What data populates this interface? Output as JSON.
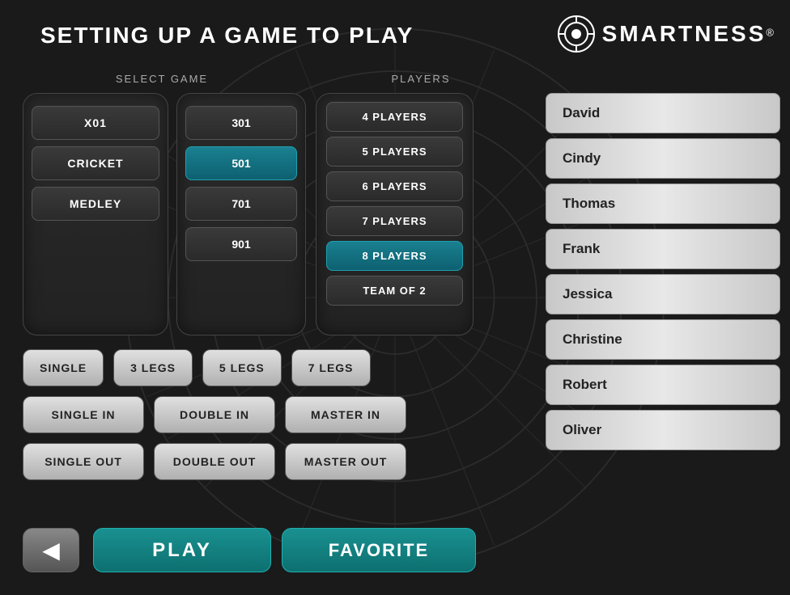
{
  "page": {
    "title": "SETTING UP A GAME TO PLAY",
    "logo": {
      "text": "SMARTNESS",
      "reg": "®"
    }
  },
  "sections": {
    "select_game_label": "SELECT GAME",
    "players_label": "PLAYERS"
  },
  "game_types": {
    "items": [
      {
        "label": "X01",
        "selected": false
      },
      {
        "label": "CRICKET",
        "selected": false
      },
      {
        "label": "MEDLEY",
        "selected": false
      }
    ]
  },
  "scores": {
    "items": [
      {
        "label": "301",
        "selected": false
      },
      {
        "label": "501",
        "selected": true
      },
      {
        "label": "701",
        "selected": false
      },
      {
        "label": "901",
        "selected": false
      }
    ]
  },
  "players": {
    "items": [
      {
        "label": "4 PLAYERS",
        "selected": false
      },
      {
        "label": "5 PLAYERS",
        "selected": false
      },
      {
        "label": "6 PLAYERS",
        "selected": false
      },
      {
        "label": "7 PLAYERS",
        "selected": false
      },
      {
        "label": "8 PLAYERS",
        "selected": true
      },
      {
        "label": "TEAM OF 2",
        "selected": false
      }
    ]
  },
  "options_row1": {
    "items": [
      {
        "label": "SINGLE",
        "teal": false
      },
      {
        "label": "3 LEGS",
        "teal": false
      },
      {
        "label": "5 LEGS",
        "teal": false
      },
      {
        "label": "7 LEGS",
        "teal": false
      }
    ]
  },
  "options_row2": {
    "items": [
      {
        "label": "SINGLE IN",
        "teal": false
      },
      {
        "label": "DOUBLE IN",
        "teal": false
      },
      {
        "label": "MASTER IN",
        "teal": false
      }
    ]
  },
  "options_row3": {
    "items": [
      {
        "label": "SINGLE OUT",
        "teal": false
      },
      {
        "label": "DOUBLE OUT",
        "teal": false
      },
      {
        "label": "MASTER OUT",
        "teal": false
      }
    ]
  },
  "player_list": {
    "items": [
      {
        "name": "David"
      },
      {
        "name": "Cindy"
      },
      {
        "name": "Thomas"
      },
      {
        "name": "Frank"
      },
      {
        "name": "Jessica"
      },
      {
        "name": "Christine"
      },
      {
        "name": "Robert"
      },
      {
        "name": "Oliver"
      }
    ]
  },
  "buttons": {
    "back_icon": "◀",
    "play": "PLAY",
    "favorite": "FAVORITE"
  }
}
